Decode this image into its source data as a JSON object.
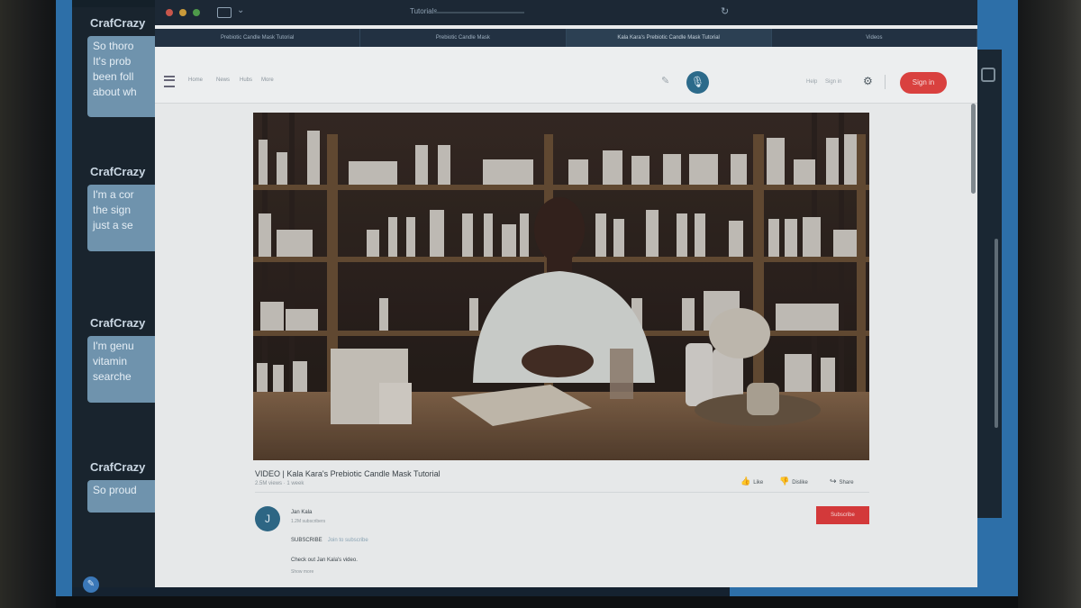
{
  "chat": {
    "messages": [
      {
        "user": "CrafCrazy",
        "text": "So thoro\nIt's prob\nbeen foll\nabout wh"
      },
      {
        "user": "CrafCrazy",
        "text": "I'm a cor\nthe sign\njust a se"
      },
      {
        "user": "CrafCrazy",
        "text": "I'm genu\nvitamin\nsearche"
      },
      {
        "user": "CrafCrazy",
        "text": "So proud"
      }
    ]
  },
  "browser": {
    "url": "Tutorials",
    "tabs": [
      {
        "label": "Prebiotic Candle Mask Tutorial",
        "active": false
      },
      {
        "label": "Prebiotic Candle Mask",
        "active": false
      },
      {
        "label": "Kala Kara's Prebiotic Candle Mask Tutorial",
        "active": true
      },
      {
        "label": "Videos",
        "active": false
      }
    ]
  },
  "site": {
    "nav": [
      "Home",
      "News",
      "Hubs",
      "More"
    ],
    "util_links": [
      "Help",
      "Sign in"
    ],
    "signin_label": "Sign in"
  },
  "video": {
    "title": "VIDEO | Kala Kara's Prebiotic Candle Mask Tutorial",
    "meta": "2.5M views · 1 week",
    "actions": {
      "like": "Like",
      "dislike": "Dislike",
      "share": "Share"
    }
  },
  "channel": {
    "avatar_letter": "J",
    "name": "Jan Kala",
    "subscribers": "1.2M subscribers",
    "subscribe_label": "Subscribe",
    "desc_line1": "SUBSCRIBE",
    "desc_extra": "Join to subscribe",
    "desc_line2": "Check out Jan Kala's video.",
    "desc_line3": "Show more"
  },
  "colors": {
    "accent_red": "#d9413f",
    "accent_blue": "#2c6a8a"
  }
}
